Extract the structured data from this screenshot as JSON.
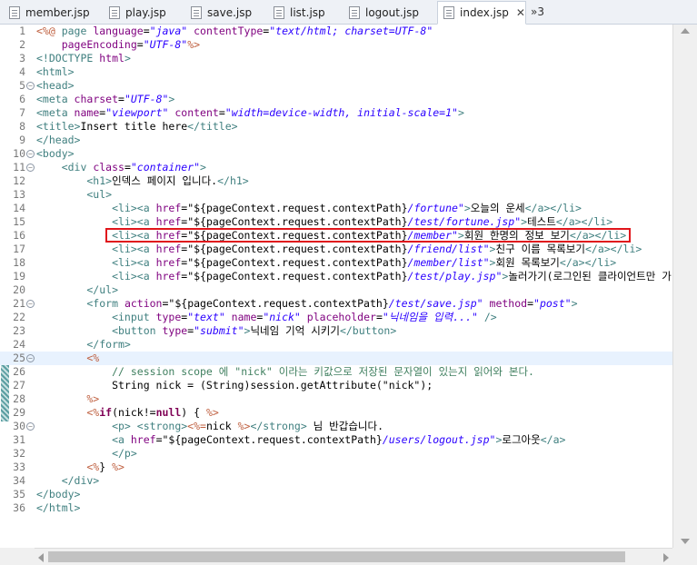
{
  "tabs": [
    {
      "label": "member.jsp"
    },
    {
      "label": "play.jsp"
    },
    {
      "label": "save.jsp"
    },
    {
      "label": "list.jsp"
    },
    {
      "label": "logout.jsp"
    },
    {
      "label": "index.jsp"
    }
  ],
  "active_tab": "index.jsp",
  "close_glyph": "✕",
  "overflow_label": "»3",
  "line_numbers": [
    "1",
    "2",
    "3",
    "4",
    "5",
    "6",
    "7",
    "8",
    "9",
    "10",
    "11",
    "12",
    "13",
    "14",
    "15",
    "16",
    "17",
    "18",
    "19",
    "20",
    "21",
    "22",
    "23",
    "24",
    "25",
    "26",
    "27",
    "28",
    "29",
    "30",
    "31",
    "32",
    "33",
    "34",
    "35",
    "36"
  ],
  "code": {
    "l1a": "<%@ ",
    "l1b": "page ",
    "l1c": "language",
    "l1d": "=",
    "l1e": "\"java\"",
    "l1f": " contentType",
    "l1g": "=",
    "l1h": "\"text/html; charset=UTF-8\"",
    "l2a": "    pageEncoding",
    "l2b": "=",
    "l2c": "\"UTF-8\"",
    "l2d": "%>",
    "l3a": "<!DOCTYPE ",
    "l3b": "html",
    "l3c": ">",
    "l4": "<html>",
    "l5": "<head>",
    "l6a": "<meta ",
    "l6b": "charset",
    "l6c": "=",
    "l6d": "\"UTF-8\"",
    "l6e": ">",
    "l7a": "<meta ",
    "l7b": "name",
    "l7c": "=",
    "l7d": "\"viewport\"",
    "l7e": " content",
    "l7f": "=",
    "l7g": "\"width=device-width, initial-scale=1\"",
    "l7h": ">",
    "l8a": "<title>",
    "l8b": "Insert title here",
    "l8c": "</title>",
    "l9": "</head>",
    "l10": "<body>",
    "l11a": "    <div ",
    "l11b": "class",
    "l11c": "=",
    "l11d": "\"container\"",
    "l11e": ">",
    "l12a": "        <h1>",
    "l12b": "인덱스 페이지 입니다.",
    "l12c": "</h1>",
    "l13": "        <ul>",
    "l14a": "            <li><a ",
    "l14b": "href",
    "l14c": "=",
    "l14d": "\"${pageContext.request.contextPath}",
    "l14e": "/fortune\"",
    "l14f": ">",
    "l14g": "오늘의 운세",
    "l14h": "</a></li>",
    "l15a": "            <li><a ",
    "l15b": "href",
    "l15c": "=",
    "l15d": "\"${pageContext.request.contextPath}",
    "l15e": "/test/fortune.jsp\"",
    "l15f": ">",
    "l15g": "테스트",
    "l15h": "</a></li>",
    "l16a": "            <li><a ",
    "l16b": "href",
    "l16c": "=",
    "l16d": "\"${pageContext.request.contextPath}",
    "l16e": "/member\"",
    "l16f": ">",
    "l16g": "회원 한명의 정보 보기",
    "l16h": "</a></li>",
    "l17a": "            <li><a ",
    "l17b": "href",
    "l17c": "=",
    "l17d": "\"${pageContext.request.contextPath}",
    "l17e": "/friend/list\"",
    "l17f": ">",
    "l17g": "친구 이름 목록보기",
    "l17h": "</a></li>",
    "l18a": "            <li><a ",
    "l18b": "href",
    "l18c": "=",
    "l18d": "\"${pageContext.request.contextPath}",
    "l18e": "/member/list\"",
    "l18f": ">",
    "l18g": "회원 목록보기",
    "l18h": "</a></li>",
    "l19a": "            <li><a ",
    "l19b": "href",
    "l19c": "=",
    "l19d": "\"${pageContext.request.contextPath}",
    "l19e": "/test/play.jsp\"",
    "l19f": ">",
    "l19g": "놀러가기(로그인된 클라이언트만 가",
    "l20": "        </ul>",
    "l21a": "        <form ",
    "l21b": "action",
    "l21c": "=",
    "l21d": "\"${pageContext.request.contextPath}",
    "l21e": "/test/save.jsp\"",
    "l21f": " method",
    "l21g": "=",
    "l21h": "\"post\"",
    "l21i": ">",
    "l22a": "            <input ",
    "l22b": "type",
    "l22c": "=",
    "l22d": "\"text\"",
    "l22e": " name",
    "l22f": "=",
    "l22g": "\"nick\"",
    "l22h": " placeholder",
    "l22i": "=",
    "l22j": "\"닉네임을 입력...\"",
    "l22k": " />",
    "l23a": "            <button ",
    "l23b": "type",
    "l23c": "=",
    "l23d": "\"submit\"",
    "l23e": ">",
    "l23f": "닉네임 기억 시키기",
    "l23g": "</button>",
    "l24": "        </form>",
    "l25": "        <%",
    "l26": "            // session scope 에 \"nick\" 이라는 키값으로 저장된 문자열이 있는지 읽어와 본다.",
    "l27": "            String nick = (String)session.getAttribute(\"nick\");",
    "l28": "        %>",
    "l29a": "        <%",
    "l29b": "if",
    "l29c": "(nick!=",
    "l29d": "null",
    "l29e": ") { ",
    "l29f": "%>",
    "l30a": "            <p> <strong>",
    "l30b": "<%=",
    "l30c": "nick ",
    "l30d": "%>",
    "l30e": "</strong>",
    "l30f": " 님 반갑습니다.",
    "l31a": "            <a ",
    "l31b": "href",
    "l31c": "=",
    "l31d": "\"${pageContext.request.contextPath}",
    "l31e": "/users/logout.jsp\"",
    "l31f": ">",
    "l31g": "로그아웃",
    "l31h": "</a>",
    "l32": "            </p>",
    "l33a": "        <%",
    "l33b": "} ",
    "l33c": "%>",
    "l34": "    </div>",
    "l35": "</body>",
    "l36": "</html>"
  }
}
